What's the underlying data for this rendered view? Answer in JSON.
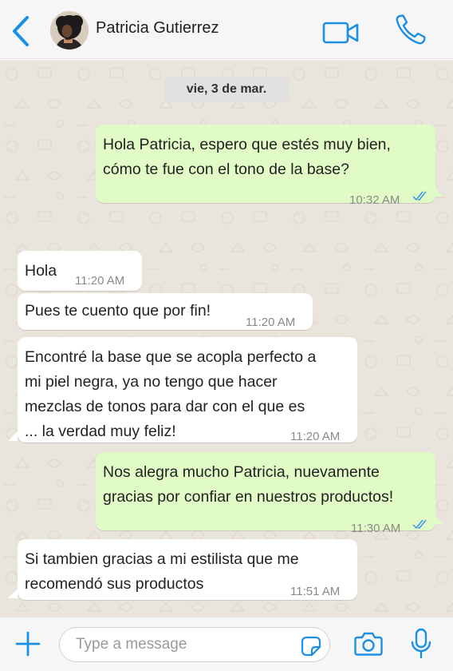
{
  "colors": {
    "accent": "#1a8fe3",
    "incoming_bubble": "#ffffff",
    "outgoing_bubble": "#e1fbc6",
    "chat_background": "#e9e4dc",
    "read_ticks": "#3d93e6"
  },
  "header": {
    "back_icon": "chevron-left-icon",
    "contact_name": "Patricia Gutierrez",
    "video_icon": "video-camera-icon",
    "call_icon": "phone-icon"
  },
  "chat": {
    "date_chip": "vie, 3 de mar.",
    "messages": [
      {
        "direction": "outgoing",
        "lines": [
          "Hola Patricia, espero que estés muy bien,",
          "cómo te fue con el tono de la base?"
        ],
        "time": "10:32 AM",
        "status": "read"
      },
      {
        "direction": "incoming",
        "lines": [
          "Hola"
        ],
        "time": "11:20 AM"
      },
      {
        "direction": "incoming",
        "lines": [
          "Pues te cuento que por fin!"
        ],
        "time": "11:20 AM"
      },
      {
        "direction": "incoming",
        "lines": [
          "Encontré la base que se acopla perfecto a",
          "mi piel negra, ya no tengo que hacer",
          "mezclas de tonos para dar con el que es",
          "... la verdad muy feliz!"
        ],
        "time": "11:20 AM"
      },
      {
        "direction": "outgoing",
        "lines": [
          "Nos alegra mucho Patricia, nuevamente",
          "gracias por confiar en nuestros productos!"
        ],
        "time": "11:30 AM",
        "status": "read"
      },
      {
        "direction": "incoming",
        "lines": [
          "Si tambien gracias a mi estilista que me",
          "recomendó sus productos"
        ],
        "time": "11:51 AM"
      }
    ]
  },
  "footer": {
    "plus_icon": "plus-icon",
    "input_placeholder": "Type a message",
    "input_value": "",
    "sticker_icon": "sticker-icon",
    "camera_icon": "camera-icon",
    "mic_icon": "microphone-icon"
  }
}
